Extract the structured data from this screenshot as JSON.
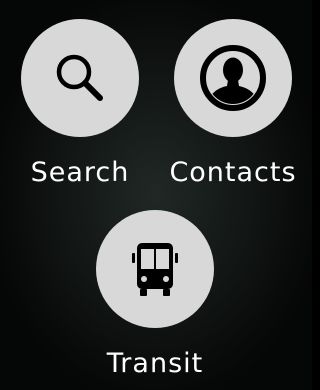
{
  "actions": {
    "search": {
      "label": "Search",
      "icon": "search-icon"
    },
    "contacts": {
      "label": "Contacts",
      "icon": "person-icon"
    },
    "transit": {
      "label": "Transit",
      "icon": "bus-icon"
    }
  },
  "colors": {
    "button_fill": "#d8d8d8",
    "icon": "#000000",
    "label": "#ffffff",
    "background": "#121614"
  }
}
